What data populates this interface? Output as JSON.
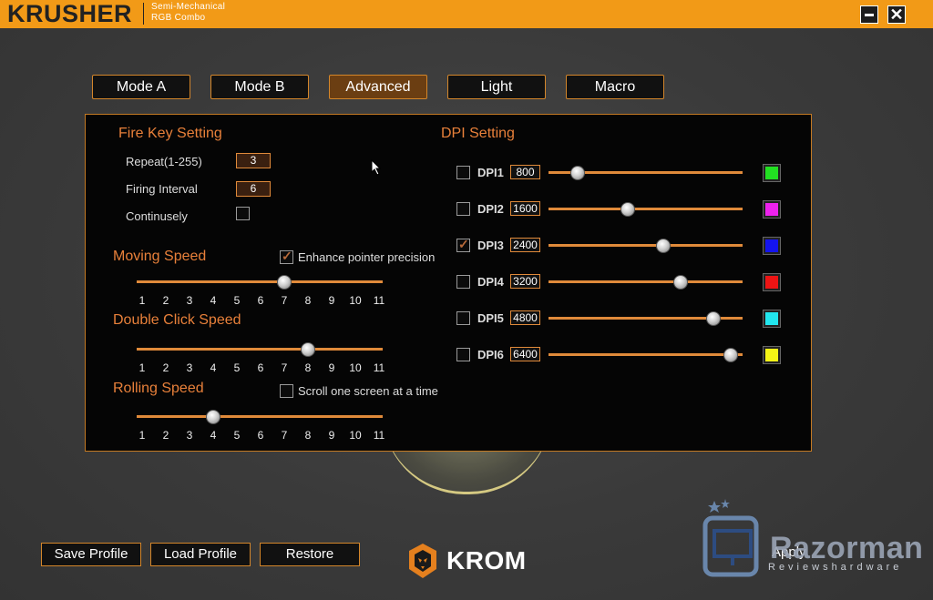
{
  "titlebar": {
    "brand": "KRUSHER",
    "subtitle_line1": "Semi-Mechanical",
    "subtitle_line2": "RGB Combo"
  },
  "tabs": [
    {
      "label": "Mode A"
    },
    {
      "label": "Mode B"
    },
    {
      "label": "Advanced",
      "active": true
    },
    {
      "label": "Light"
    },
    {
      "label": "Macro"
    }
  ],
  "fire_key": {
    "title": "Fire Key Setting",
    "repeat_label": "Repeat(1-255)",
    "repeat_value": "3",
    "interval_label": "Firing Interval",
    "interval_value": "6",
    "continuous_label": "Continusely",
    "continuous_checked": false
  },
  "moving_speed": {
    "title": "Moving Speed",
    "value": 7,
    "enhance_label": "Enhance pointer precision",
    "enhance_checked": true
  },
  "double_click": {
    "title": "Double Click Speed",
    "value": 8
  },
  "rolling": {
    "title": "Rolling Speed",
    "value": 4,
    "scroll_label": "Scroll one screen at a time",
    "scroll_checked": false
  },
  "scale": [
    "1",
    "2",
    "3",
    "4",
    "5",
    "6",
    "7",
    "8",
    "9",
    "10",
    "11"
  ],
  "dpi": {
    "title": "DPI Setting",
    "items": [
      {
        "name": "DPI1",
        "value": "800",
        "checked": false,
        "level": 0.15,
        "color": "#22e022"
      },
      {
        "name": "DPI2",
        "value": "1600",
        "checked": false,
        "level": 0.41,
        "color": "#ee22ee"
      },
      {
        "name": "DPI3",
        "value": "2400",
        "checked": true,
        "level": 0.59,
        "color": "#1414ee"
      },
      {
        "name": "DPI4",
        "value": "3200",
        "checked": false,
        "level": 0.68,
        "color": "#ee1414"
      },
      {
        "name": "DPI5",
        "value": "4800",
        "checked": false,
        "level": 0.85,
        "color": "#22e6ee"
      },
      {
        "name": "DPI6",
        "value": "6400",
        "checked": false,
        "level": 0.94,
        "color": "#f4f416"
      }
    ]
  },
  "footer": {
    "save": "Save Profile",
    "load": "Load Profile",
    "restore": "Restore",
    "logo_text": "KROM",
    "apply": "Apply",
    "watermark_name": "Razorman",
    "watermark_sub": "Reviewshardware"
  },
  "colors": {
    "accent": "#f29a17",
    "border": "#d4862a",
    "heading": "#e8803a"
  }
}
